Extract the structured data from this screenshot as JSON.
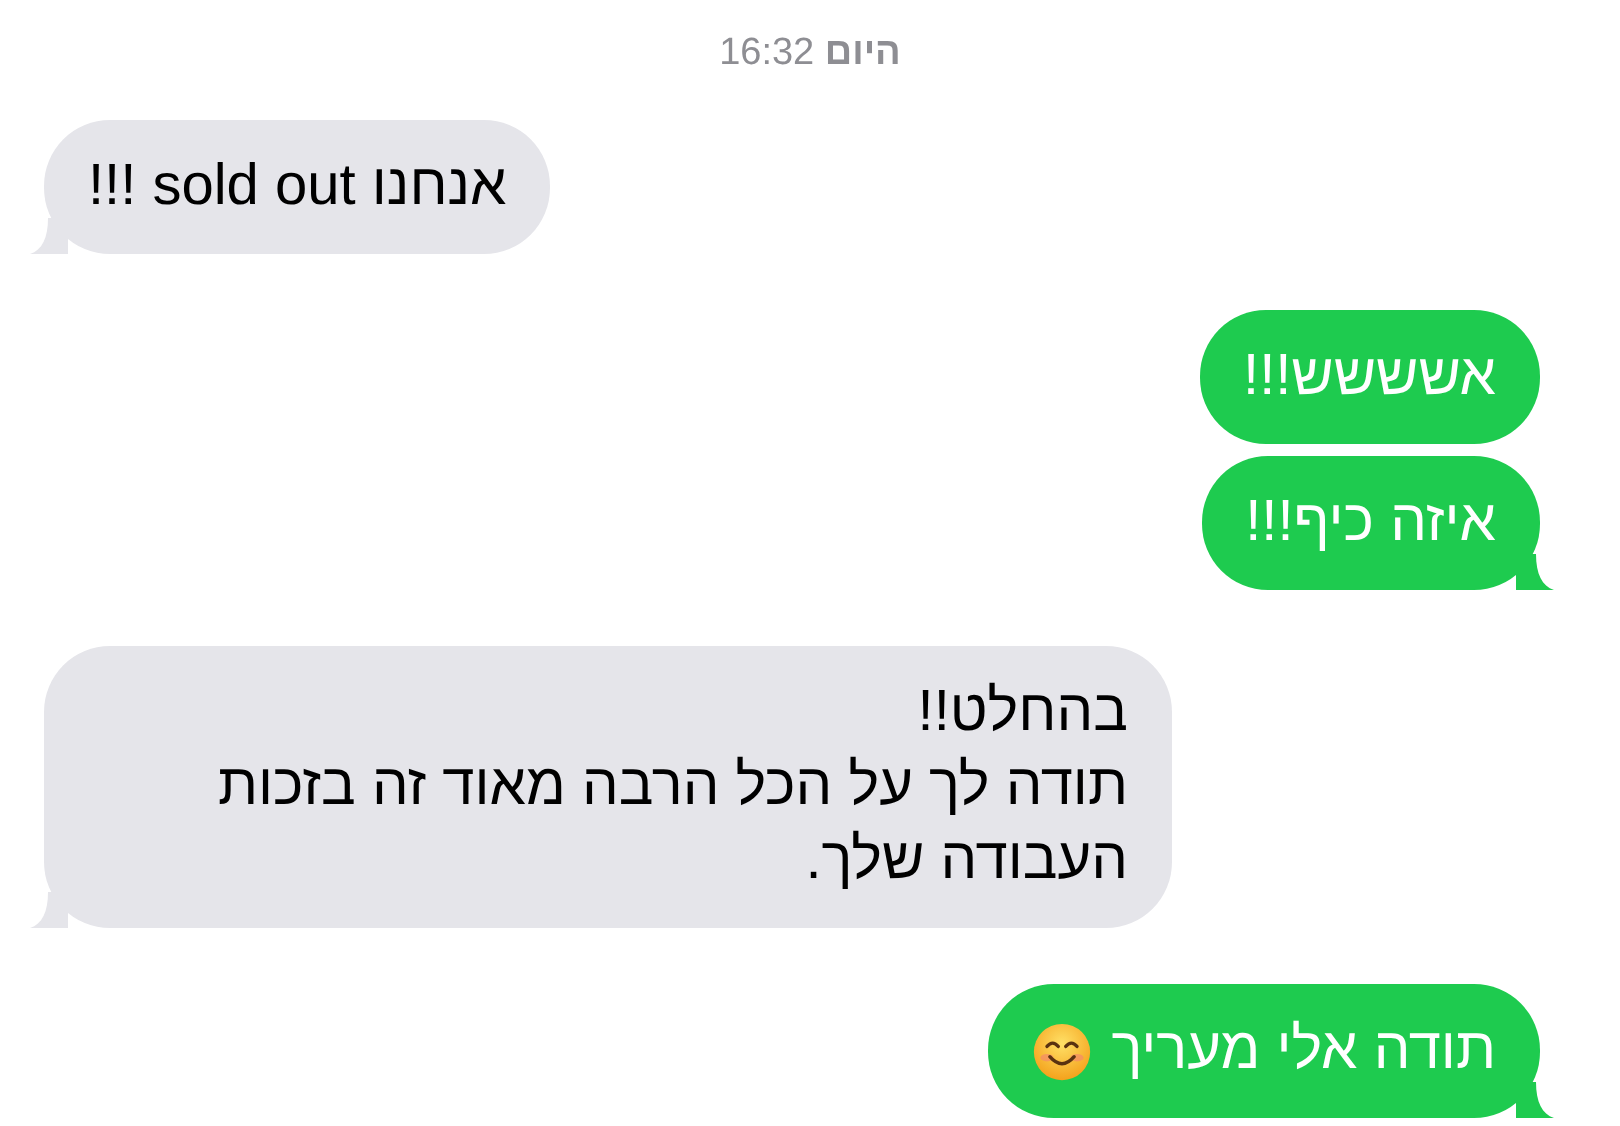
{
  "timestamp": "**היום** 16:32",
  "messages": [
    {
      "kind": "incoming",
      "text": "אנחנו sold out !!!",
      "tail": true
    },
    {
      "kind": "outgoing",
      "text": "אשששש!!!",
      "tail": false
    },
    {
      "kind": "outgoing",
      "text": "איזה כיף!!!",
      "tail": true
    },
    {
      "kind": "incoming",
      "text": "בהחלט!!\nתודה לך על הכל הרבה מאוד זה בזכות העבודה שלך.",
      "tail": true
    },
    {
      "kind": "outgoing",
      "text": "תודה אלי מעריך",
      "tail": true,
      "emoji": true
    }
  ]
}
